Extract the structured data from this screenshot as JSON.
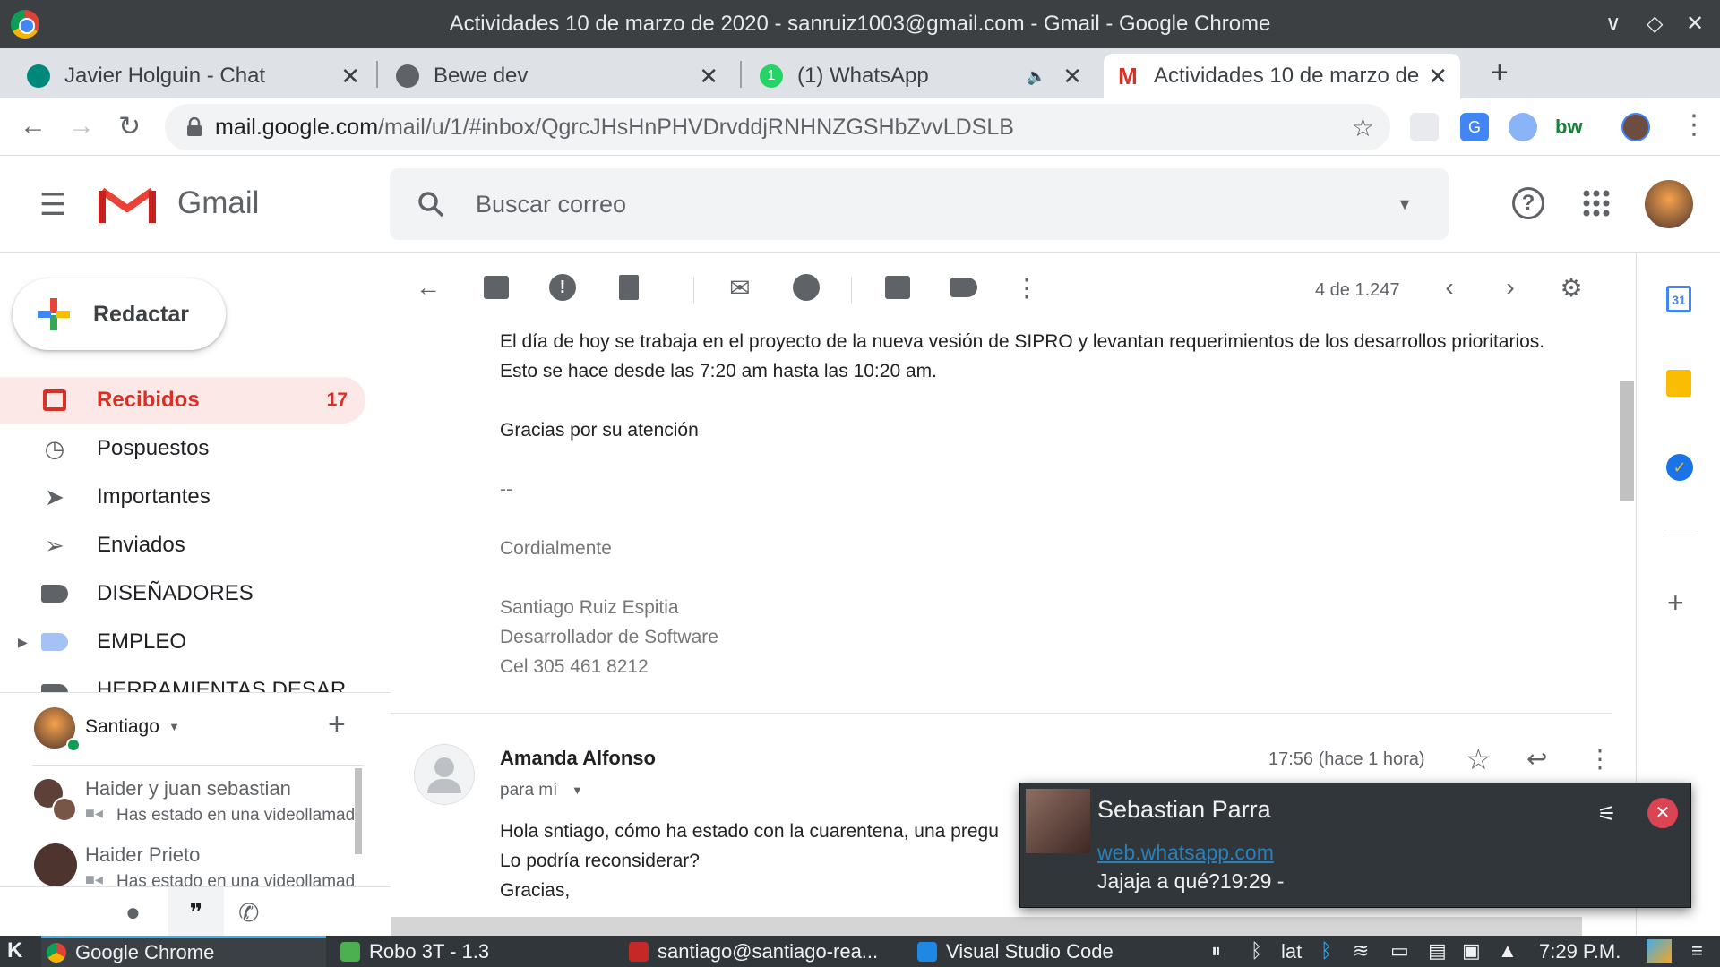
{
  "window": {
    "title": "Actividades 10 de marzo de 2020 - sanruiz1003@gmail.com - Gmail - Google Chrome",
    "controls": [
      "∨",
      "◇",
      "✕"
    ]
  },
  "tabs": [
    {
      "label": "Javier Holguin - Chat",
      "icon": "hangouts-chat-icon",
      "color": "#00897b"
    },
    {
      "label": "Bewe dev",
      "icon": "globe-icon",
      "color": "#5f6368"
    },
    {
      "label": "(1) WhatsApp",
      "icon": "whatsapp-icon",
      "color": "#25d366",
      "badge": "1",
      "audio": "🔈"
    },
    {
      "label": "Actividades 10 de marzo de 2020",
      "icon": "gmail-icon",
      "color": "#d93025",
      "active": true
    }
  ],
  "new_tab_label": "+",
  "omnibox": {
    "host": "mail.google.com",
    "path": "/mail/u/1/#inbox/QgrcJHsHnPHVDrvddjRNHNZGSHbZvvLDSLB"
  },
  "gmail": {
    "product_name": "Gmail",
    "search_placeholder": "Buscar correo"
  },
  "compose_label": "Redactar",
  "nav": [
    {
      "label": "Recibidos",
      "count": "17",
      "icon": "inbox-icon",
      "active": true
    },
    {
      "label": "Pospuestos",
      "icon": "clock-icon"
    },
    {
      "label": "Importantes",
      "icon": "important-icon"
    },
    {
      "label": "Enviados",
      "icon": "send-icon"
    },
    {
      "label": "DISEÑADORES",
      "icon": "label-icon",
      "color": "#5f6368"
    },
    {
      "label": "EMPLEO",
      "icon": "label-icon",
      "color": "#a4c2f4"
    },
    {
      "label": "HERRAMIENTAS DESAR",
      "icon": "label-icon",
      "color": "#5f6368"
    }
  ],
  "hangouts": {
    "user": "Santiago",
    "add_label": "+",
    "conversations": [
      {
        "name": "Haider y juan sebastian",
        "status": "Has estado en una videollamada"
      },
      {
        "name": "Haider Prieto",
        "status": "Has estado en una videollamada"
      }
    ]
  },
  "toolbar": {
    "pagination": "4 de 1.247"
  },
  "message1": {
    "lines": [
      "El día de hoy se trabaja en el proyecto de la nueva vesión de SIPRO y levantan requerimientos de los desarrollos prioritarios.",
      "Esto se hace desde las 7:20 am hasta las 10:20 am.",
      "Gracias por su atención"
    ],
    "signature": [
      "--",
      "Cordialmente",
      "Santiago Ruiz Espitia",
      "Desarrollador de Software",
      "Cel 305 461 8212"
    ]
  },
  "message2": {
    "sender": "Amanda Alfonso",
    "recipient": "para mí",
    "time": "17:56 (hace 1 hora)",
    "lines": [
      "Hola sntiago, cómo ha estado con la cuarentena, una pregu",
      "Lo podría reconsiderar?",
      "Gracias,"
    ]
  },
  "notification": {
    "title": "Sebastian Parra",
    "source": "web.whatsapp.com",
    "message": "Jajaja a qué?19:29 -"
  },
  "taskbar": {
    "apps": [
      {
        "label": "Google Chrome",
        "icon": "chrome-icon"
      },
      {
        "label": "Robo 3T - 1.3",
        "icon": "robo3t-icon"
      },
      {
        "label": "santiago@santiago-rea...",
        "icon": "terminal-icon"
      },
      {
        "label": "Visual Studio Code",
        "icon": "vscode-icon"
      }
    ],
    "keyboard_layout": "lat",
    "clock": "7:29 P.M."
  },
  "colors": {
    "gmail_red": "#d93025",
    "chrome_frame": "#3c4043",
    "active_nav_bg": "#fce8e6",
    "taskbar": "#31363b"
  }
}
